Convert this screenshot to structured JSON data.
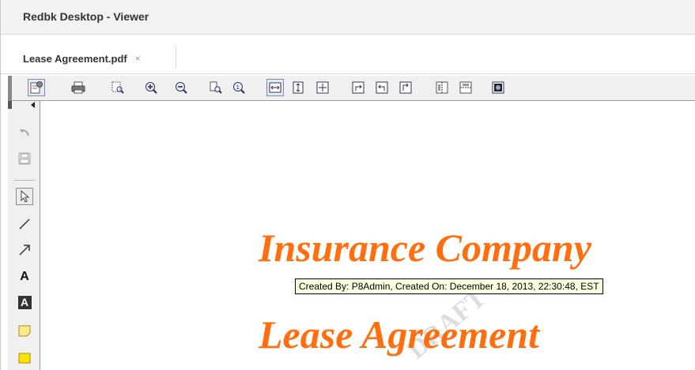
{
  "window": {
    "title": "Redbk Desktop - Viewer"
  },
  "tabs": [
    {
      "label": "Lease Agreement.pdf",
      "close": "×"
    }
  ],
  "toolbar": {
    "items": [
      "settings-icon",
      "print-icon",
      "page-zoom-icon",
      "zoom-in-icon",
      "zoom-out-icon",
      "fit-page-icon",
      "actual-size-icon",
      "fit-width-icon",
      "fit-height-icon",
      "fit-window-icon",
      "rotate-right-icon",
      "rotate-left-icon",
      "rotate-icon",
      "flip-horizontal-icon",
      "flip-vertical-icon",
      "invert-icon"
    ]
  },
  "sidebar": {
    "items": [
      "undo-icon",
      "save-icon",
      "select-pointer-icon",
      "line-icon",
      "arrow-icon",
      "text-icon",
      "text-box-icon",
      "sticky-note-icon",
      "highlight-icon"
    ],
    "text_tool_label": "A"
  },
  "document": {
    "heading": "Insurance Company",
    "subheading": "Lease Agreement",
    "watermark": "DRAFT",
    "tooltip": "Created By: P8Admin,  Created On: December 18, 2013, 22:30:48, EST"
  },
  "colors": {
    "heading": "#ff6f0f",
    "tooltip_bg": "#ffffe1",
    "toolbar_bg": "#f0f0f0"
  }
}
